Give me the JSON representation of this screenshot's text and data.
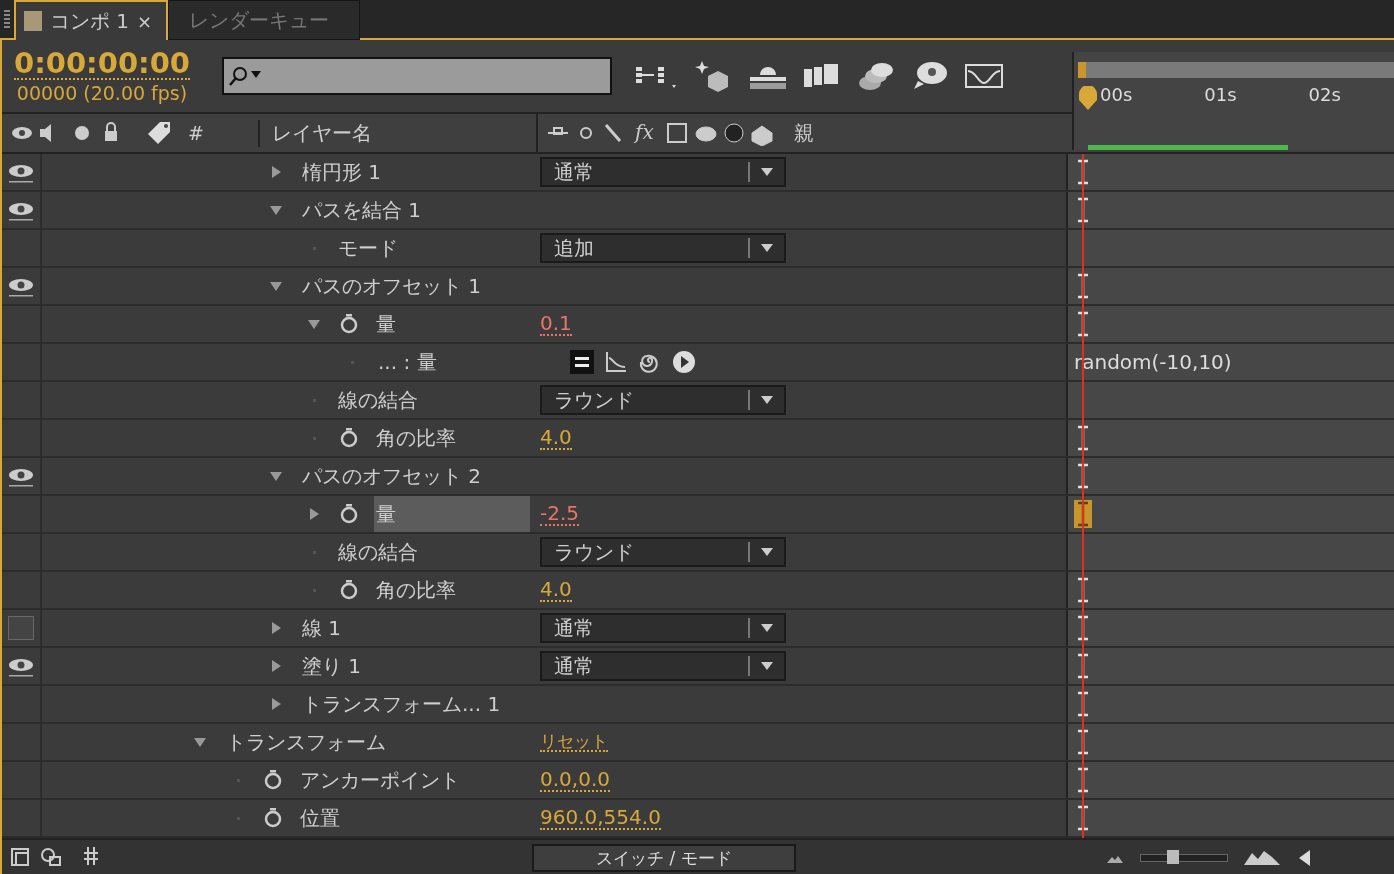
{
  "tabs": [
    {
      "label": "コンポ 1",
      "close": "×",
      "selected": true
    },
    {
      "label": "レンダーキュー",
      "selected": false
    }
  ],
  "timecode": "0:00:00:00",
  "frame_info": "00000 (20.00 fps)",
  "columns": {
    "number": "#",
    "layer_name": "レイヤー名",
    "effects_switch": "fx",
    "parent": "親"
  },
  "ruler": [
    "00s",
    "01s",
    "02s"
  ],
  "contents": [
    {
      "label": "楕円形 1",
      "kind": "group",
      "expanded": false,
      "visible": true,
      "dropdown": "通常",
      "keyframe_marker": true,
      "selected": false
    },
    {
      "label": "パスを結合 1",
      "kind": "group",
      "expanded": true,
      "visible": true,
      "keyframe_marker": true,
      "selected": false,
      "children": [
        {
          "label": "モード",
          "kind": "property",
          "dropdown": "追加",
          "keyframe_marker": false,
          "selected": false
        }
      ]
    },
    {
      "label": "パスのオフセット 1",
      "kind": "group",
      "expanded": true,
      "visible": true,
      "keyframe_marker": true,
      "selected": false,
      "children": [
        {
          "label": "量",
          "kind": "animatable",
          "expanded": true,
          "value": "0.1",
          "expression": true,
          "keyframe_marker": true,
          "selected": false,
          "children": [
            {
              "label": "... : 量",
              "kind": "expression",
              "expression_text": "random(-10,10)",
              "selected": false
            }
          ]
        },
        {
          "label": "線の結合",
          "kind": "property",
          "dropdown": "ラウンド",
          "keyframe_marker": false,
          "selected": false
        },
        {
          "label": "角の比率",
          "kind": "animatable",
          "value": "4.0",
          "expression": false,
          "keyframe_marker": true,
          "selected": false
        }
      ]
    },
    {
      "label": "パスのオフセット 2",
      "kind": "group",
      "expanded": true,
      "visible": true,
      "keyframe_marker": true,
      "selected": false,
      "children": [
        {
          "label": "量",
          "kind": "animatable",
          "expanded": false,
          "value": "-2.5",
          "expression": true,
          "keyframe_marker": true,
          "selected": true
        },
        {
          "label": "線の結合",
          "kind": "property",
          "dropdown": "ラウンド",
          "keyframe_marker": false,
          "selected": false
        },
        {
          "label": "角の比率",
          "kind": "animatable",
          "value": "4.0",
          "expression": false,
          "keyframe_marker": true,
          "selected": false
        }
      ]
    },
    {
      "label": "線 1",
      "kind": "group",
      "expanded": false,
      "visible": false,
      "dropdown": "通常",
      "keyframe_marker": true,
      "selected": false
    },
    {
      "label": "塗り 1",
      "kind": "group",
      "expanded": false,
      "visible": true,
      "dropdown": "通常",
      "keyframe_marker": true,
      "selected": false
    },
    {
      "label": "トランスフォーム... 1",
      "kind": "group",
      "expanded": false,
      "keyframe_marker": true,
      "selected": false
    }
  ],
  "transform": {
    "label": "トランスフォーム",
    "kind": "group",
    "expanded": true,
    "reset_link": "リセット",
    "keyframe_marker": true,
    "selected": false,
    "children": [
      {
        "label": "アンカーポイント",
        "kind": "animatable",
        "value": "0.0,0.0",
        "expression": false,
        "keyframe_marker": true,
        "selected": false
      },
      {
        "label": "位置",
        "kind": "animatable",
        "value": "960.0,554.0",
        "expression": false,
        "keyframe_marker": true,
        "selected": false
      }
    ]
  },
  "footer": {
    "mode_button": "スイッチ / モード",
    "zoom_slider": {
      "level": 0.35
    }
  }
}
